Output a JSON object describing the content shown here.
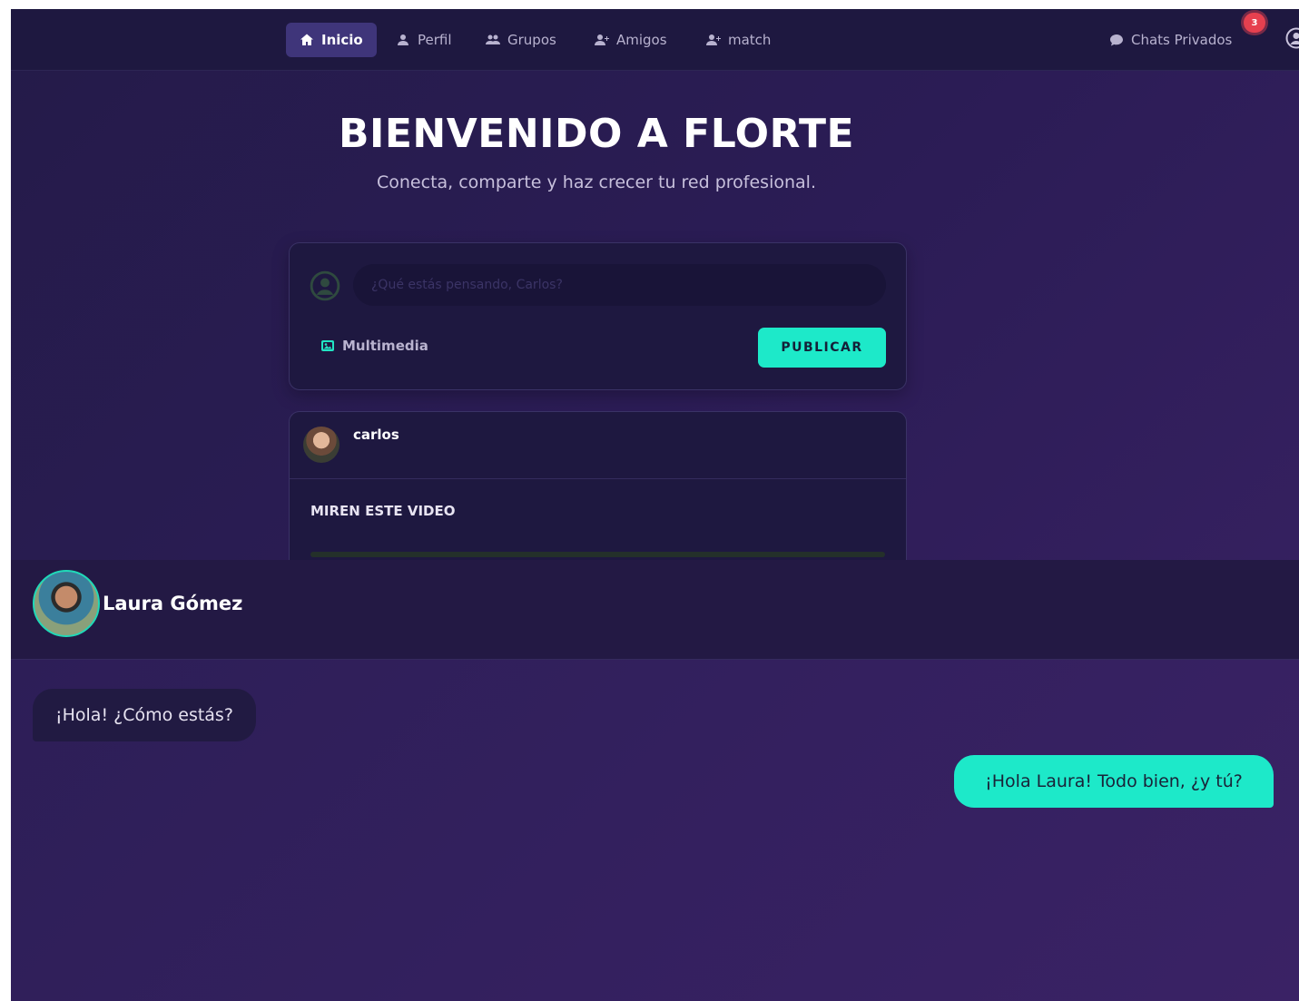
{
  "nav": {
    "items": [
      {
        "label": "Inicio",
        "icon": "home-icon",
        "active": true
      },
      {
        "label": "Perfil",
        "icon": "user-icon"
      },
      {
        "label": "Grupos",
        "icon": "users-icon"
      },
      {
        "label": "Amigos",
        "icon": "user-plus-icon"
      },
      {
        "label": "match",
        "icon": "user-plus-icon"
      }
    ],
    "chats_label": "Chats Privados",
    "chats_badge": "3",
    "accent_color": "#1de9c9"
  },
  "hero": {
    "title": "BIENVENIDO A FLORTE",
    "subtitle": "Conecta, comparte y haz crecer tu red profesional."
  },
  "composer": {
    "placeholder": "¿Qué estás pensando, Carlos?",
    "media_label": "Multimedia",
    "publish_label": "PUBLICAR"
  },
  "post": {
    "author": "carlos",
    "text": "MIREN ESTE VIDEO"
  },
  "chat": {
    "contact_name": "Laura Gómez",
    "messages": [
      {
        "from": "contact",
        "text": "¡Hola! ¿Cómo estás?"
      },
      {
        "from": "me",
        "text": "¡Hola Laura! Todo bien, ¿y tú?"
      }
    ]
  }
}
